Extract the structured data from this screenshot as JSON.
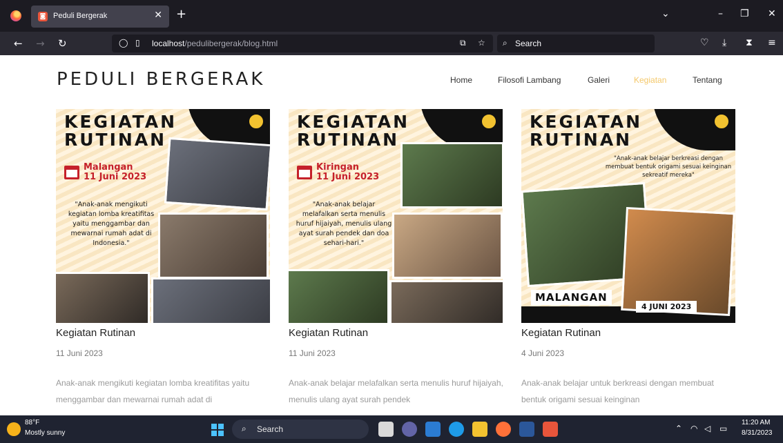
{
  "browser": {
    "tab_title": "Peduli Bergerak",
    "url_host": "localhost",
    "url_path": "/pedulibergerak/blog.html",
    "search_placeholder": "Search"
  },
  "site": {
    "brand": "PEDULI BERGERAK",
    "menu": [
      "Home",
      "Filosofi Lambang",
      "Galeri",
      "Kegiatan",
      "Tentang"
    ],
    "active_menu": "Kegiatan",
    "accent_color": "#f4c86a"
  },
  "posts": [
    {
      "poster_title": "KEGIATAN RUTINAN",
      "poster_place": "Malangan",
      "poster_date": "11 Juni 2023",
      "poster_quote": "\"Anak-anak mengikuti kegiatan lomba kreatifitas yaitu menggambar dan mewarnai rumah adat di Indonesia.\"",
      "title": "Kegiatan Rutinan",
      "date": "11 Juni 2023",
      "excerpt": "Anak-anak mengikuti kegiatan lomba kreatifitas yaitu menggambar dan mewarnai rumah adat di"
    },
    {
      "poster_title": "KEGIATAN RUTINAN",
      "poster_place": "Kiringan",
      "poster_date": "11 Juni 2023",
      "poster_quote": "\"Anak-anak belajar melafalkan serta menulis huruf hijaiyah, menulis ulang ayat surah pendek dan doa sehari-hari.\"",
      "title": "Kegiatan Rutinan",
      "date": "11 Juni 2023",
      "excerpt": "Anak-anak belajar melafalkan serta menulis huruf hijaiyah, menulis ulang ayat surah pendek"
    },
    {
      "poster_title": "KEGIATAN RUTINAN",
      "poster_quote": "\"Anak-anak belajar berkreasi dengan membuat bentuk origami sesuai keinginan sekreatif mereka\"",
      "poster_place_label": "MALANGAN",
      "poster_date_label": "4 JUNI 2023",
      "title": "Kegiatan Rutinan",
      "date": "4 Juni 2023",
      "excerpt": "Anak-anak belajar untuk berkreasi dengan membuat bentuk origami sesuai keinginan"
    }
  ],
  "taskbar": {
    "temp": "88°F",
    "weather": "Mostly sunny",
    "search": "Search",
    "time": "11:20 AM",
    "date": "8/31/2023"
  }
}
